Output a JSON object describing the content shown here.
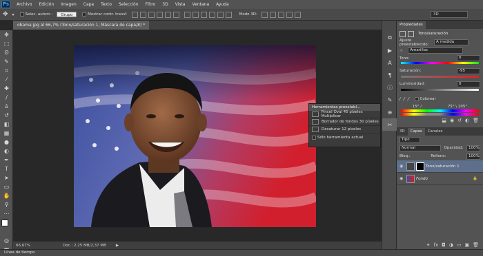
{
  "menubar": {
    "logo": "Ps",
    "items": [
      "Archivo",
      "Edición",
      "Imagen",
      "Capa",
      "Texto",
      "Selección",
      "Filtro",
      "3D",
      "Vista",
      "Ventana",
      "Ayuda"
    ]
  },
  "options": {
    "select_label": "Selec. autom.:",
    "select_value": "Grupo",
    "transform_label": "Mostrar contr. transf.",
    "mode3d": "Modo 3D:",
    "workspace": "3D"
  },
  "document": {
    "tab_title": "obama.jpg al 66,7% (Tono/saturación 1, Máscara de capa/8) *",
    "zoom": "66,67%",
    "doc_size": "Doc.: 2,25 MB/2,37 MB"
  },
  "timeline": {
    "label": "Línea de tiempo"
  },
  "tool_presets": {
    "title": "Herramientas preestabl...",
    "items": [
      "Pincel Oval 45 píxeles Multiplicar",
      "Borrador de fondos 30 píxeles",
      "Desaturar 12 píxeles"
    ],
    "current_only": "Sólo herramienta actual"
  },
  "properties": {
    "tab": "Propiedades",
    "title": "Tono/saturación",
    "preset_label": "Ajuste preestablecido:",
    "preset_value": "A medida",
    "channel": "Amarillos",
    "tono_label": "Tono:",
    "tono_value": "0",
    "saturacion_label": "Saturación:",
    "saturacion_value": "-95",
    "luminosidad_label": "Luminosidad:",
    "luminosidad_value": "0",
    "colorear": "Colorear",
    "range_1": "15° /",
    "range_2": "75° \\ 105°"
  },
  "layers": {
    "tabs": [
      "3D",
      "Capas",
      "Canales"
    ],
    "kind": "Tipo",
    "blend": "Normal",
    "opacity_label": "Opacidad:",
    "opacity": "100%",
    "lock_label": "Bloq.:",
    "fill_label": "Relleno:",
    "fill": "100%",
    "rows": [
      {
        "name": "Tono/saturación 1"
      },
      {
        "name": "Fondo"
      }
    ]
  }
}
